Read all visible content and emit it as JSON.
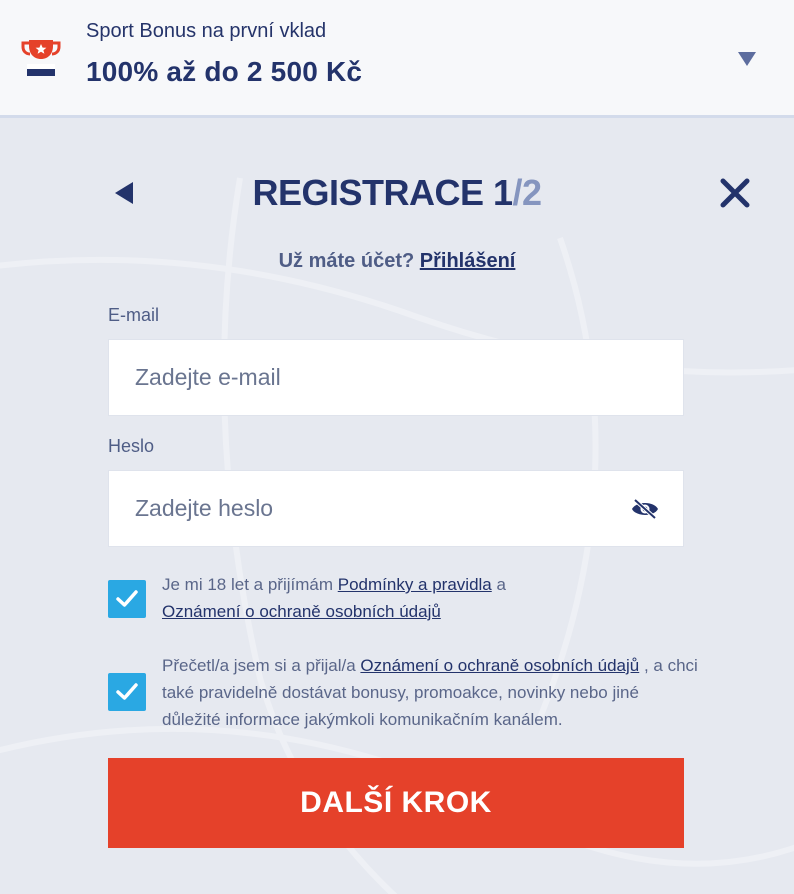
{
  "bonus": {
    "subtitle": "Sport Bonus na první vklad",
    "amount": "100% až do 2 500 Kč",
    "icon": "trophy-icon",
    "toggle_icon": "chevron-down-icon"
  },
  "header": {
    "title_main": "REGISTRACE 1",
    "title_slash": "/2",
    "back_icon": "back-arrow-icon",
    "close_icon": "close-icon"
  },
  "login": {
    "prompt": "Už máte účet?",
    "link": "Přihlášení"
  },
  "form": {
    "email": {
      "label": "E-mail",
      "placeholder": "Zadejte e-mail",
      "value": ""
    },
    "password": {
      "label": "Heslo",
      "placeholder": "Zadejte heslo",
      "value": "",
      "toggle_icon": "eye-off-icon"
    }
  },
  "consents": [
    {
      "checked": true,
      "text_before": "Je mi 18 let a přijímám",
      "link1": "Podmínky a pravidla",
      "text_middle": "a",
      "link2": "Oznámení o ochraně osobních údajů"
    },
    {
      "checked": true,
      "text_before": "Přečetl/a jsem si a přijal/a",
      "link1": "Oznámení o ochraně osobních údajů",
      "text_after": ", a chci také pravidelně dostávat bonusy, promoakce, novinky nebo jiné důležité informace jakýmkoli komunikačním kanálem."
    }
  ],
  "next_button": "DALŠÍ KROK",
  "colors": {
    "primary_navy": "#23336b",
    "accent_red": "#e5412a",
    "checkbox_blue": "#2aa8e3",
    "background": "#e6e9f0"
  }
}
